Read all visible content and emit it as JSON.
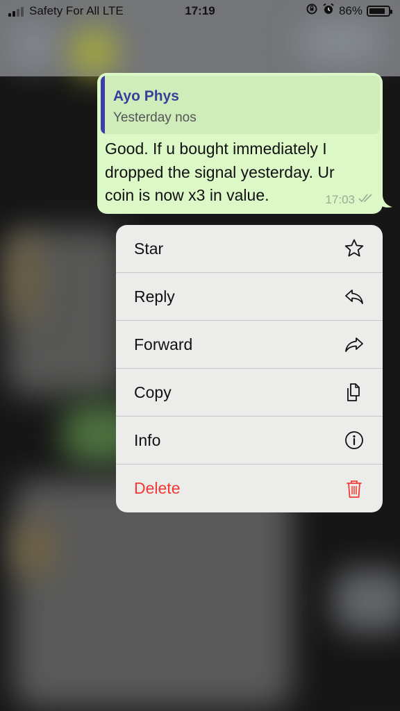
{
  "status_bar": {
    "carrier": "Safety For All  LTE",
    "time": "17:19",
    "battery": "86%",
    "battery_level": 0.86,
    "icons": [
      "signal-icon",
      "orientation-lock-icon",
      "alarm-icon",
      "battery-icon"
    ]
  },
  "message": {
    "quote": {
      "sender": "Ayo Phys",
      "text": "Yesterday nos"
    },
    "lines": [
      "Good. If u bought immediately I",
      "dropped the signal yesterday. Ur",
      "coin is now x3 in value."
    ],
    "time": "17:03",
    "receipt_icon": "double-check-icon",
    "colors": {
      "bubble": "#dcf8c6",
      "quote_bar": "#3e3ea8",
      "sender": "#3a3f9c"
    }
  },
  "menu": {
    "items": [
      {
        "label": "Star",
        "icon": "star-icon"
      },
      {
        "label": "Reply",
        "icon": "reply-icon"
      },
      {
        "label": "Forward",
        "icon": "forward-icon"
      },
      {
        "label": "Copy",
        "icon": "copy-icon"
      },
      {
        "label": "Info",
        "icon": "info-icon"
      },
      {
        "label": "Delete",
        "icon": "trash-icon",
        "color": "#f03a33"
      }
    ]
  }
}
